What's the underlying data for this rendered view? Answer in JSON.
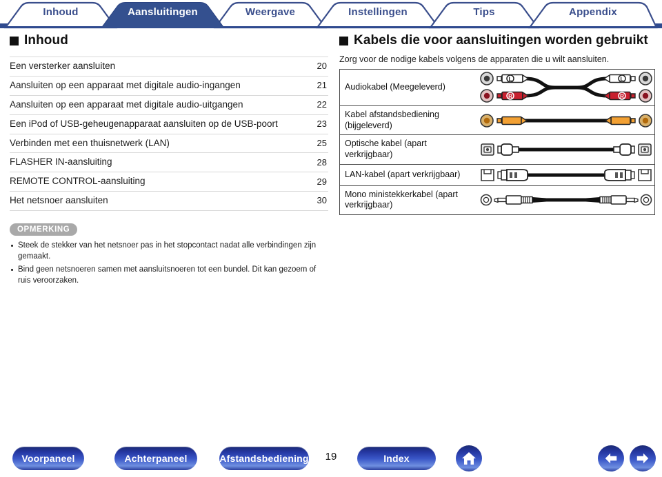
{
  "tabs": [
    {
      "label": "Inhoud",
      "active": false
    },
    {
      "label": "Aansluitingen",
      "active": true
    },
    {
      "label": "Weergave",
      "active": false
    },
    {
      "label": "Instellingen",
      "active": false
    },
    {
      "label": "Tips",
      "active": false
    },
    {
      "label": "Appendix",
      "active": false
    }
  ],
  "left": {
    "heading": "Inhoud",
    "toc": [
      {
        "title": "Een versterker aansluiten",
        "page": "20"
      },
      {
        "title": "Aansluiten op een apparaat met digitale audio-ingangen",
        "page": "21"
      },
      {
        "title": "Aansluiten op een apparaat met digitale audio-uitgangen",
        "page": "22"
      },
      {
        "title": "Een iPod of USB-geheugenapparaat aansluiten op de USB-poort",
        "page": "23"
      },
      {
        "title": "Verbinden met een thuisnetwerk (LAN)",
        "page": "25"
      },
      {
        "title": "FLASHER IN-aansluiting",
        "page": "28"
      },
      {
        "title": "REMOTE CONTROL-aansluiting",
        "page": "29"
      },
      {
        "title": "Het netsnoer aansluiten",
        "page": "30"
      }
    ],
    "note_badge": "OPMERKING",
    "notes": [
      "Steek de stekker van het netsnoer pas in het stopcontact nadat alle verbindingen zijn gemaakt.",
      "Bind geen netsnoeren samen met aansluitsnoeren tot een bundel. Dit kan gezoem of ruis veroorzaken."
    ]
  },
  "right": {
    "heading": "Kabels die voor aansluitingen worden gebruikt",
    "lead": "Zorg voor de nodige kabels volgens de apparaten die u wilt aansluiten.",
    "cables": [
      {
        "name": "Audiokabel (Meegeleverd)",
        "art": "rca-stereo"
      },
      {
        "name": "Kabel afstandsbediening (bijgeleverd)",
        "art": "rca-mono-orange"
      },
      {
        "name": "Optische kabel (apart verkrijgbaar)",
        "art": "optical"
      },
      {
        "name": "LAN-kabel (apart verkrijgbaar)",
        "art": "lan"
      },
      {
        "name": "Mono ministekkerkabel (apart verkrijgbaar)",
        "art": "miniplug"
      }
    ]
  },
  "bottom": {
    "buttons": [
      {
        "label": "Voorpaneel"
      },
      {
        "label": "Achterpaneel"
      },
      {
        "label": "Afstandsbediening"
      },
      {
        "label": "Index"
      }
    ],
    "page_number": "19",
    "home_icon": "home-icon",
    "prev_icon": "arrow-left-icon",
    "next_icon": "arrow-right-icon"
  },
  "colors": {
    "tab_active": "#34508F",
    "tab_outline": "#3A4E8C",
    "tab_text": "#3A4E8C",
    "pill_dark": "#1b2a74",
    "pill_light": "#6f8fe0",
    "note_badge_bg": "#a9a9a9",
    "rule": "#d8d8d8",
    "table_border": "#4a4a4a"
  }
}
